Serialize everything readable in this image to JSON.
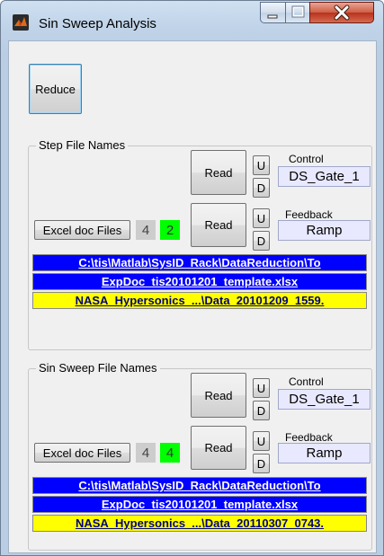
{
  "window": {
    "title": "Sin Sweep Analysis",
    "icon": "matlab-icon",
    "caption_buttons": {
      "minimize_icon": "minimize-icon",
      "maximize_icon": "maximize-icon",
      "close_icon": "close-icon"
    }
  },
  "reduce_label": "Reduce",
  "step": {
    "title": "Step File Names",
    "control": {
      "read_label": "Read",
      "up_label": "U",
      "down_label": "D",
      "caption": "Control",
      "value": "DS_Gate_1"
    },
    "feedback": {
      "read_label": "Read",
      "up_label": "U",
      "down_label": "D",
      "caption": "Feedback",
      "value": "Ramp"
    },
    "excel_label": "Excel doc Files",
    "count_total": "4",
    "count_selected": "2",
    "paths": [
      "C:\\tis\\Matlab\\SysID_Rack\\DataReduction\\To",
      "ExpDoc_tis20101201_template.xlsx",
      "NASA_Hypersonics_...\\Data_20101209_1559."
    ]
  },
  "sweep": {
    "title": "Sin Sweep File Names",
    "control": {
      "read_label": "Read",
      "up_label": "U",
      "down_label": "D",
      "caption": "Control",
      "value": "DS_Gate_1"
    },
    "feedback": {
      "read_label": "Read",
      "up_label": "U",
      "down_label": "D",
      "caption": "Feedback",
      "value": "Ramp"
    },
    "excel_label": "Excel doc Files",
    "count_total": "4",
    "count_selected": "4",
    "paths": [
      "C:\\tis\\Matlab\\SysID_Rack\\DataReduction\\To",
      "ExpDoc_tis20101201_template.xlsx",
      "NASA_Hypersonics_...\\Data_20110307_0743."
    ]
  },
  "colors": {
    "path_blue": "#0000ff",
    "path_yellow": "#ffff00",
    "count_green": "#00ff00",
    "value_box": "#e8e8ff"
  }
}
